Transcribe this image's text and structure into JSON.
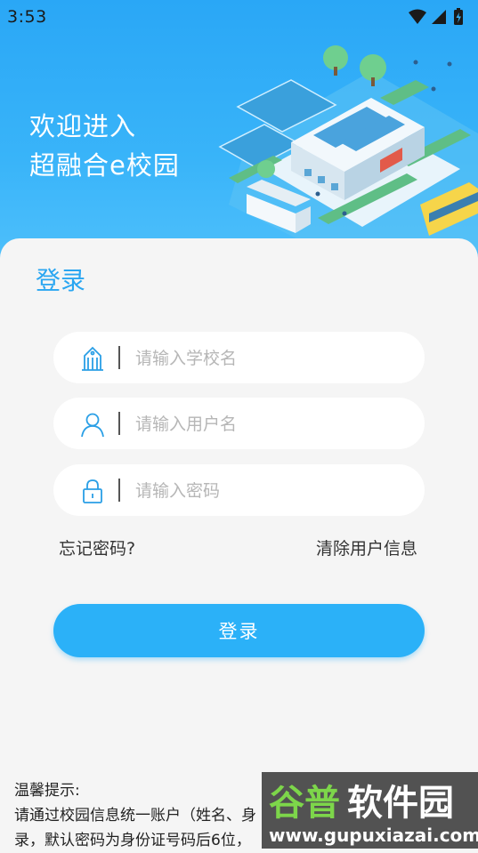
{
  "status_bar": {
    "time": "3:53"
  },
  "hero": {
    "line1": "欢迎进入",
    "line2": "超融合e校园"
  },
  "login_card": {
    "title": "登录",
    "fields": {
      "school": {
        "placeholder": "请输入学校名",
        "icon": "school-building-icon"
      },
      "username": {
        "placeholder": "请输入用户名",
        "icon": "user-icon"
      },
      "password": {
        "placeholder": "请输入密码",
        "icon": "lock-icon"
      }
    },
    "forgot_password": "忘记密码?",
    "clear_user_info": "清除用户信息",
    "login_button": "登录"
  },
  "tips": {
    "heading": "温馨提示:",
    "line1": "请通过校园信息统一账户（姓名、身",
    "line2": "录，默认密码为身份证号码后6位，"
  },
  "watermark": {
    "brand": "谷普软件园",
    "url": "www.gupuxiazai.com"
  },
  "colors": {
    "accent": "#2bb1f8",
    "hero_top": "#2aa7f6",
    "title_blue": "#2aa6f1",
    "background": "#f5f5f5"
  }
}
